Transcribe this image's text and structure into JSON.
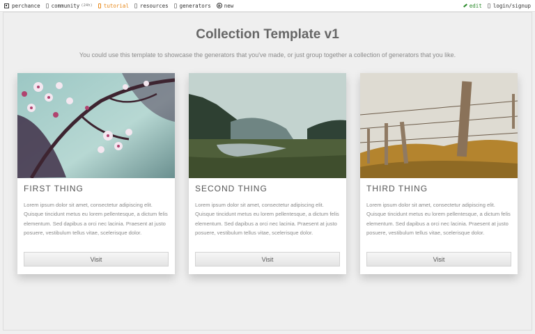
{
  "topbar": {
    "site": "perchance",
    "community": "community",
    "community_badge": "(24h)",
    "tutorial": "tutorial",
    "resources": "resources",
    "generators": "generators",
    "new": "new",
    "edit": "edit",
    "login": "login/signup"
  },
  "page": {
    "title": "Collection Template v1",
    "subtitle": "You could use this template to showcase the generators that you've made, or just group together a collection of generators that you like."
  },
  "cards": [
    {
      "title": "FIRST THING",
      "text": "Lorem ipsum dolor sit amet, consectetur adipiscing elit. Quisque tincidunt metus eu lorem pellentesque, a dictum felis elementum. Sed dapibus a orci nec lacinia. Praesent at justo posuere, vestibulum tellus vitae, scelerisque dolor.",
      "button": "Visit"
    },
    {
      "title": "SECOND THING",
      "text": "Lorem ipsum dolor sit amet, consectetur adipiscing elit. Quisque tincidunt metus eu lorem pellentesque, a dictum felis elementum. Sed dapibus a orci nec lacinia. Praesent at justo posuere, vestibulum tellus vitae, scelerisque dolor.",
      "button": "Visit"
    },
    {
      "title": "THIRD THING",
      "text": "Lorem ipsum dolor sit amet, consectetur adipiscing elit. Quisque tincidunt metus eu lorem pellentesque, a dictum felis elementum. Sed dapibus a orci nec lacinia. Praesent at justo posuere, vestibulum tellus vitae, scelerisque dolor.",
      "button": "Visit"
    }
  ],
  "colors": {
    "accent_tutorial": "#e8891b",
    "accent_edit": "#2a8a2a"
  }
}
